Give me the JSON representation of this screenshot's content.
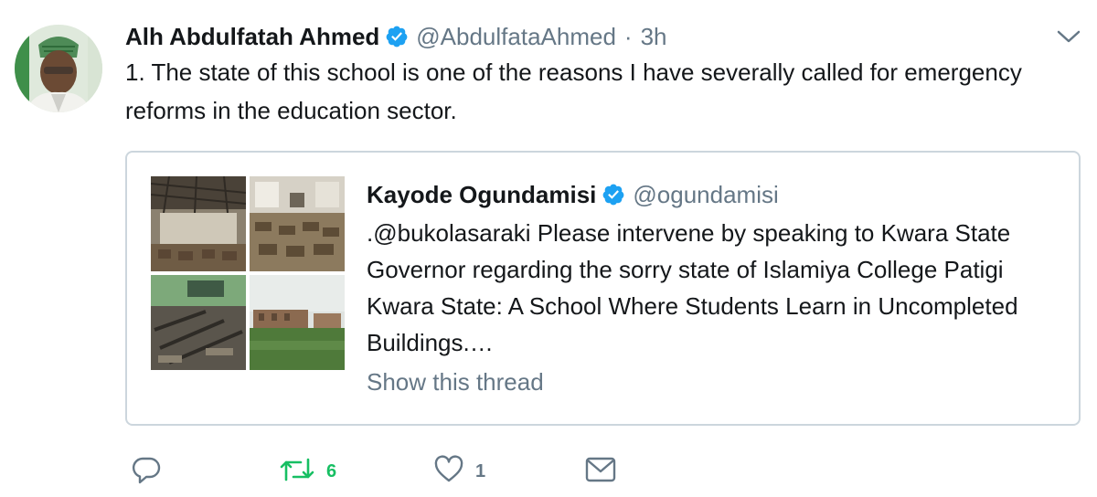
{
  "tweet": {
    "author_name": "Alh Abdulfatah Ahmed",
    "handle": "@AbdulfataAhmed",
    "separator": "·",
    "time": "3h",
    "text": "1. The state of this school is one of the reasons I have severally called for emergency reforms in the education sector."
  },
  "quoted": {
    "author_name": "Kayode Ogundamisi",
    "handle": "@ogundamisi",
    "text": ".@bukolasaraki Please intervene by speaking to Kwara State Governor regarding the sorry state of Islamiya College Patigi Kwara State: A School Where Students Learn in Uncompleted Buildings.…",
    "show_thread": "Show this thread"
  },
  "actions": {
    "reply_icon": "reply-icon",
    "retweet_icon": "retweet-icon",
    "retweet_count": "6",
    "like_icon": "heart-icon",
    "like_count": "1",
    "message_icon": "envelope-icon"
  },
  "colors": {
    "verified": "#1da1f2",
    "text": "#14171a",
    "secondary": "#657786",
    "retweet_active": "#17bf63",
    "border": "#ccd6dd"
  }
}
